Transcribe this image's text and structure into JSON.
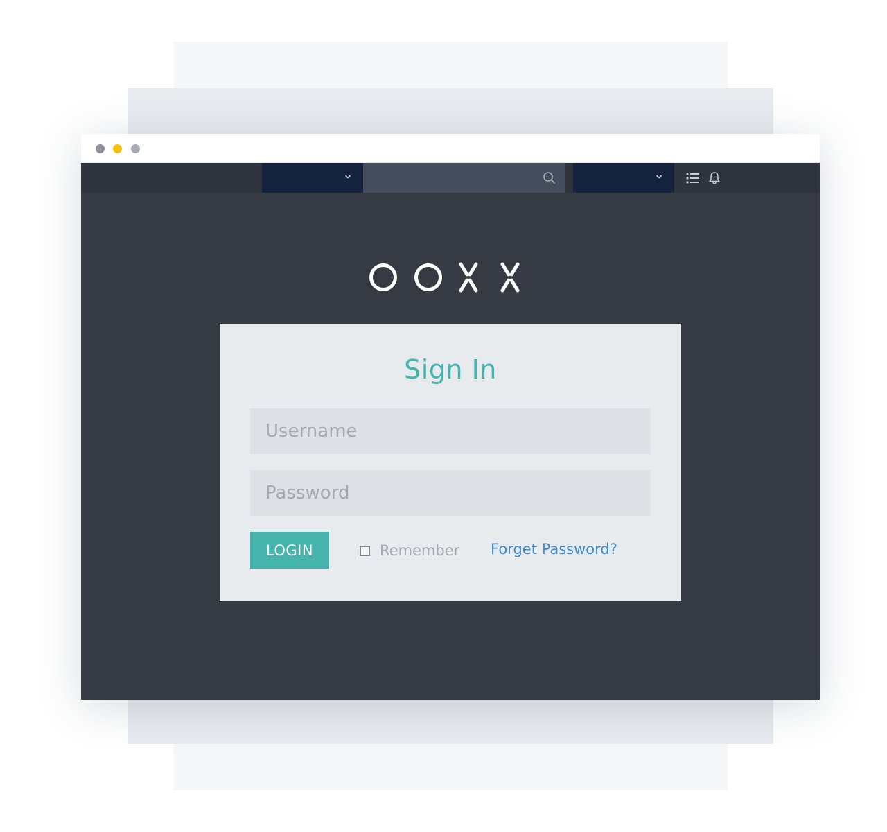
{
  "colors": {
    "accent": "#45b4ad",
    "link": "#3f8ac8",
    "window_background": "#363a42",
    "navbar_dropdown": "#16233e",
    "navbar_search": "#454d5c",
    "card_background": "#e8ebee",
    "traffic_light_close": "#8d9096",
    "traffic_light_minimize": "#f4c20d",
    "traffic_light_maximize": "#a7adb6"
  },
  "navbar": {
    "dropdowns": [
      {
        "icon": "chevron-down-icon"
      },
      {
        "icon": "chevron-down-icon"
      }
    ],
    "search": {
      "icon": "search-icon"
    },
    "icons": [
      "list-icon",
      "bell-icon"
    ]
  },
  "logo": {
    "text": "OOXX"
  },
  "login": {
    "title": "Sign In",
    "username_placeholder": "Username",
    "password_placeholder": "Password",
    "login_button": "LOGIN",
    "remember_label": "Remember",
    "remember_checked": false,
    "forgot_link": "Forget Password?"
  }
}
